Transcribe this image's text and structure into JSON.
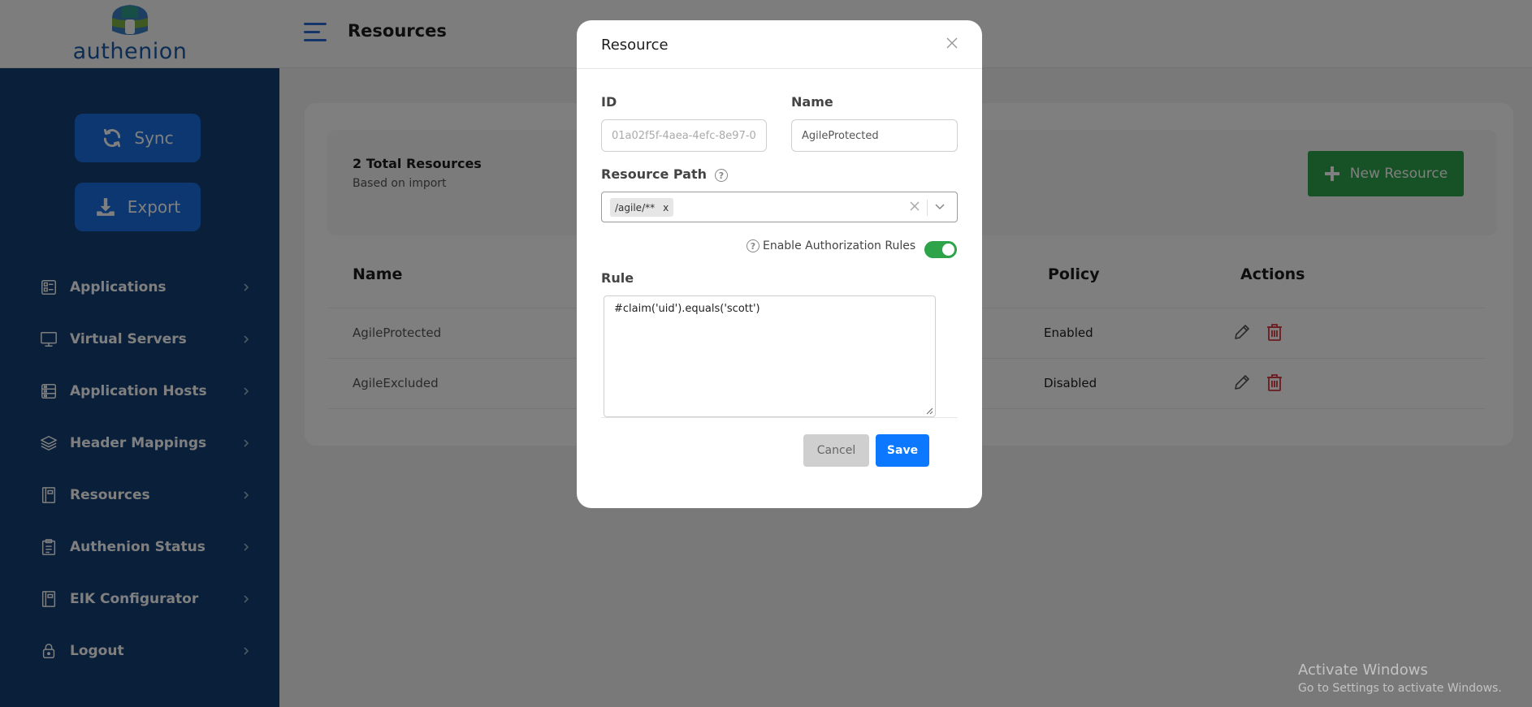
{
  "header": {
    "logo_text": "authenion",
    "page_title": "Resources"
  },
  "sidebar": {
    "sync_label": "Sync",
    "export_label": "Export",
    "items": [
      {
        "label": "Applications",
        "icon": "applications-icon"
      },
      {
        "label": "Virtual Servers",
        "icon": "monitor-icon"
      },
      {
        "label": "Application Hosts",
        "icon": "server-icon"
      },
      {
        "label": "Header Mappings",
        "icon": "layers-icon"
      },
      {
        "label": "Resources",
        "icon": "book-icon"
      },
      {
        "label": "Authenion Status",
        "icon": "clipboard-icon"
      },
      {
        "label": "EIK Configurator",
        "icon": "book-icon"
      },
      {
        "label": "Logout",
        "icon": "lock-icon"
      }
    ]
  },
  "main": {
    "total_title": "2 Total Resources",
    "total_subtitle": "Based on import",
    "new_button_label": "New Resource",
    "columns": {
      "name": "Name",
      "policy": "Policy",
      "actions": "Actions"
    },
    "rows": [
      {
        "name": "AgileProtected",
        "policy": "Enabled"
      },
      {
        "name": "AgileExcluded",
        "policy": "Disabled"
      }
    ]
  },
  "modal": {
    "title": "Resource",
    "id_label": "ID",
    "id_placeholder": "01a02f5f-4aea-4efc-8e97-0",
    "name_label": "Name",
    "name_value": "AgileProtected",
    "path_label": "Resource Path",
    "path_chip": "/agile/**",
    "enable_rules_label": "Enable Authorization Rules",
    "enable_rules_on": true,
    "rule_label": "Rule",
    "rule_value": "#claim('uid').equals('scott')",
    "cancel_label": "Cancel",
    "save_label": "Save"
  },
  "watermark": {
    "line1": "Activate Windows",
    "line2": "Go to Settings to activate Windows."
  },
  "colors": {
    "sidebar_bg": "#133e74",
    "primary_button": "#1a6fe0",
    "success": "#2da44a",
    "save": "#0b78ff",
    "danger": "#d9363e"
  }
}
